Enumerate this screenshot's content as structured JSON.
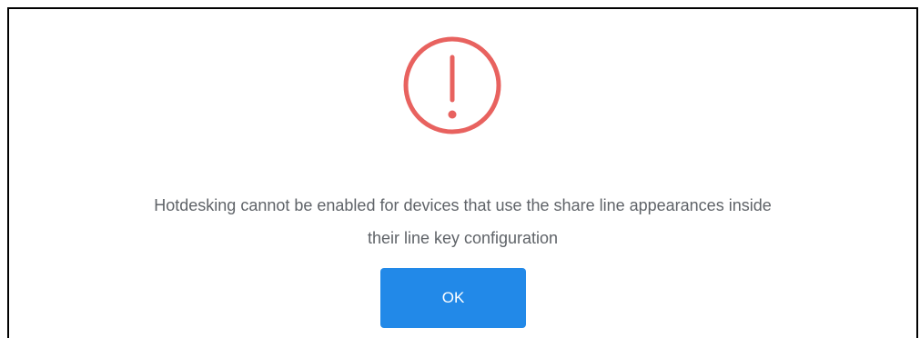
{
  "dialog": {
    "icon": "exclamation-circle-icon",
    "message_line1": "Hotdesking cannot be enabled for devices that use the share line appearances inside",
    "message_line2": "their line key configuration",
    "ok_label": "OK"
  },
  "colors": {
    "icon": "#e8625f",
    "button": "#2289e8",
    "button_text": "#ffffff",
    "message_text": "#5f6368"
  }
}
